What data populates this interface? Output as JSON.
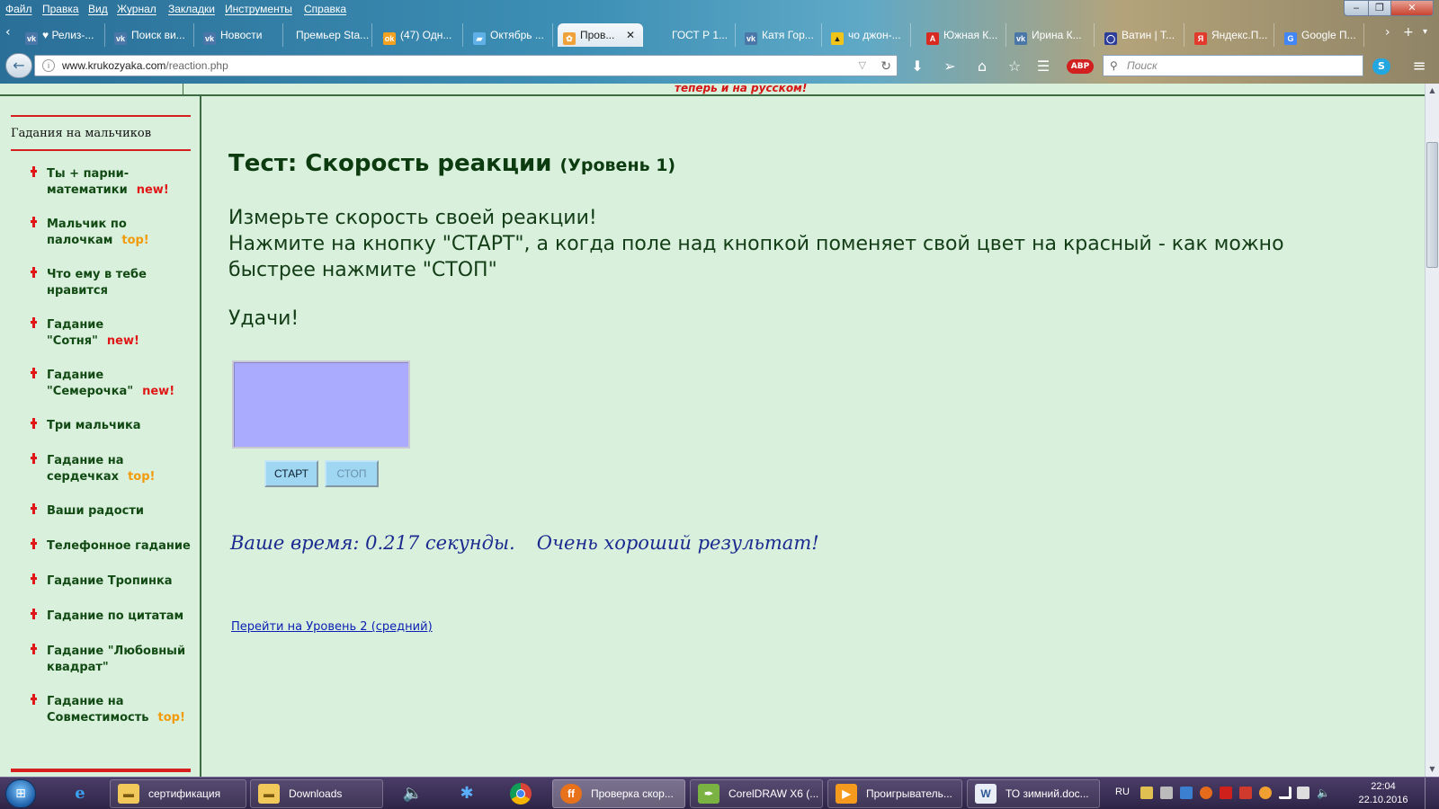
{
  "menubar": [
    "Файл",
    "Правка",
    "Вид",
    "Журнал",
    "Закладки",
    "Инструменты",
    "Справка"
  ],
  "tabs": [
    {
      "label": "♥ Релиз-...",
      "icon": "vk"
    },
    {
      "label": "Поиск ви...",
      "icon": "vk"
    },
    {
      "label": "Новости",
      "icon": "vk"
    },
    {
      "label": "Премьер Sta...",
      "icon": "none"
    },
    {
      "label": "(47) Одн...",
      "icon": "ok"
    },
    {
      "label": "Октябрь ...",
      "icon": "chat"
    },
    {
      "label": "Пров...",
      "icon": "fox"
    },
    {
      "label": "ГОСТ Р 1...",
      "icon": "none"
    },
    {
      "label": "Катя Гор...",
      "icon": "vk"
    },
    {
      "label": "чо джон-...",
      "icon": "pic"
    },
    {
      "label": "Южная К...",
      "icon": "a"
    },
    {
      "label": "Ирина К...",
      "icon": "vk"
    },
    {
      "label": "Ватин | Т...",
      "icon": "ring"
    },
    {
      "label": "Яндекс.П...",
      "icon": "y"
    },
    {
      "label": "Google П...",
      "icon": "g"
    }
  ],
  "url": {
    "host": "www.krukozyaka.com",
    "path": "/reaction.php"
  },
  "search": {
    "placeholder": "Поиск"
  },
  "banner": "теперь и на русском!",
  "sidebar": {
    "heading": "Гадания на мальчиков",
    "items": [
      {
        "label": "Ты + парни-математики",
        "badge": "new!",
        "badge_type": "new"
      },
      {
        "label": "Мальчик по палочкам",
        "badge": "top!",
        "badge_type": "top"
      },
      {
        "label": "Что ему в тебе нравится",
        "badge": "",
        "badge_type": ""
      },
      {
        "label": "Гадание \"Сотня\"",
        "badge": "new!",
        "badge_type": "new"
      },
      {
        "label": "Гадание \"Семерочка\"",
        "badge": "new!",
        "badge_type": "new"
      },
      {
        "label": "Три мальчика",
        "badge": "",
        "badge_type": ""
      },
      {
        "label": "Гадание на сердечках",
        "badge": "top!",
        "badge_type": "top"
      },
      {
        "label": "Ваши радости",
        "badge": "",
        "badge_type": ""
      },
      {
        "label": "Телефонное гадание",
        "badge": "",
        "badge_type": ""
      },
      {
        "label": "Гадание Тропинка",
        "badge": "",
        "badge_type": ""
      },
      {
        "label": "Гадание по цитатам",
        "badge": "",
        "badge_type": ""
      },
      {
        "label": "Гадание \"Любовный квадрат\"",
        "badge": "",
        "badge_type": ""
      },
      {
        "label": "Гадание на Совместимость",
        "badge": "top!",
        "badge_type": "top"
      }
    ]
  },
  "main": {
    "title": "Тест: Скорость реакции",
    "level": "(Уровень 1)",
    "instruction_1": "Измерьте скорость своей реакции!",
    "instruction_2": "Нажмите на кнопку \"СТАРТ\", а когда поле над кнопкой поменяет свой цвет на красный - как можно быстрее нажмите \"СТОП\"",
    "luck": "Удачи!",
    "box_color": "#aaaafe",
    "start_label": "СТАРТ",
    "stop_label": "СТОП",
    "result_time": "Ваше время: 0.217 секунды.",
    "result_comment": "Очень хороший результат!",
    "next_link": "Перейти на Уровень 2 (средний)"
  },
  "taskbar": {
    "items": [
      {
        "label": "сертификация",
        "icon": "folder"
      },
      {
        "label": "Downloads",
        "icon": "folder"
      },
      {
        "label": "Проверка скор...",
        "icon": "firefox"
      },
      {
        "label": "CorelDRAW X6 (...",
        "icon": "corel"
      },
      {
        "label": "Проигрыватель...",
        "icon": "player"
      },
      {
        "label": "ТО зимний.doc...",
        "icon": "word"
      }
    ],
    "lang": "RU",
    "time": "22:04",
    "date": "22.10.2016"
  }
}
